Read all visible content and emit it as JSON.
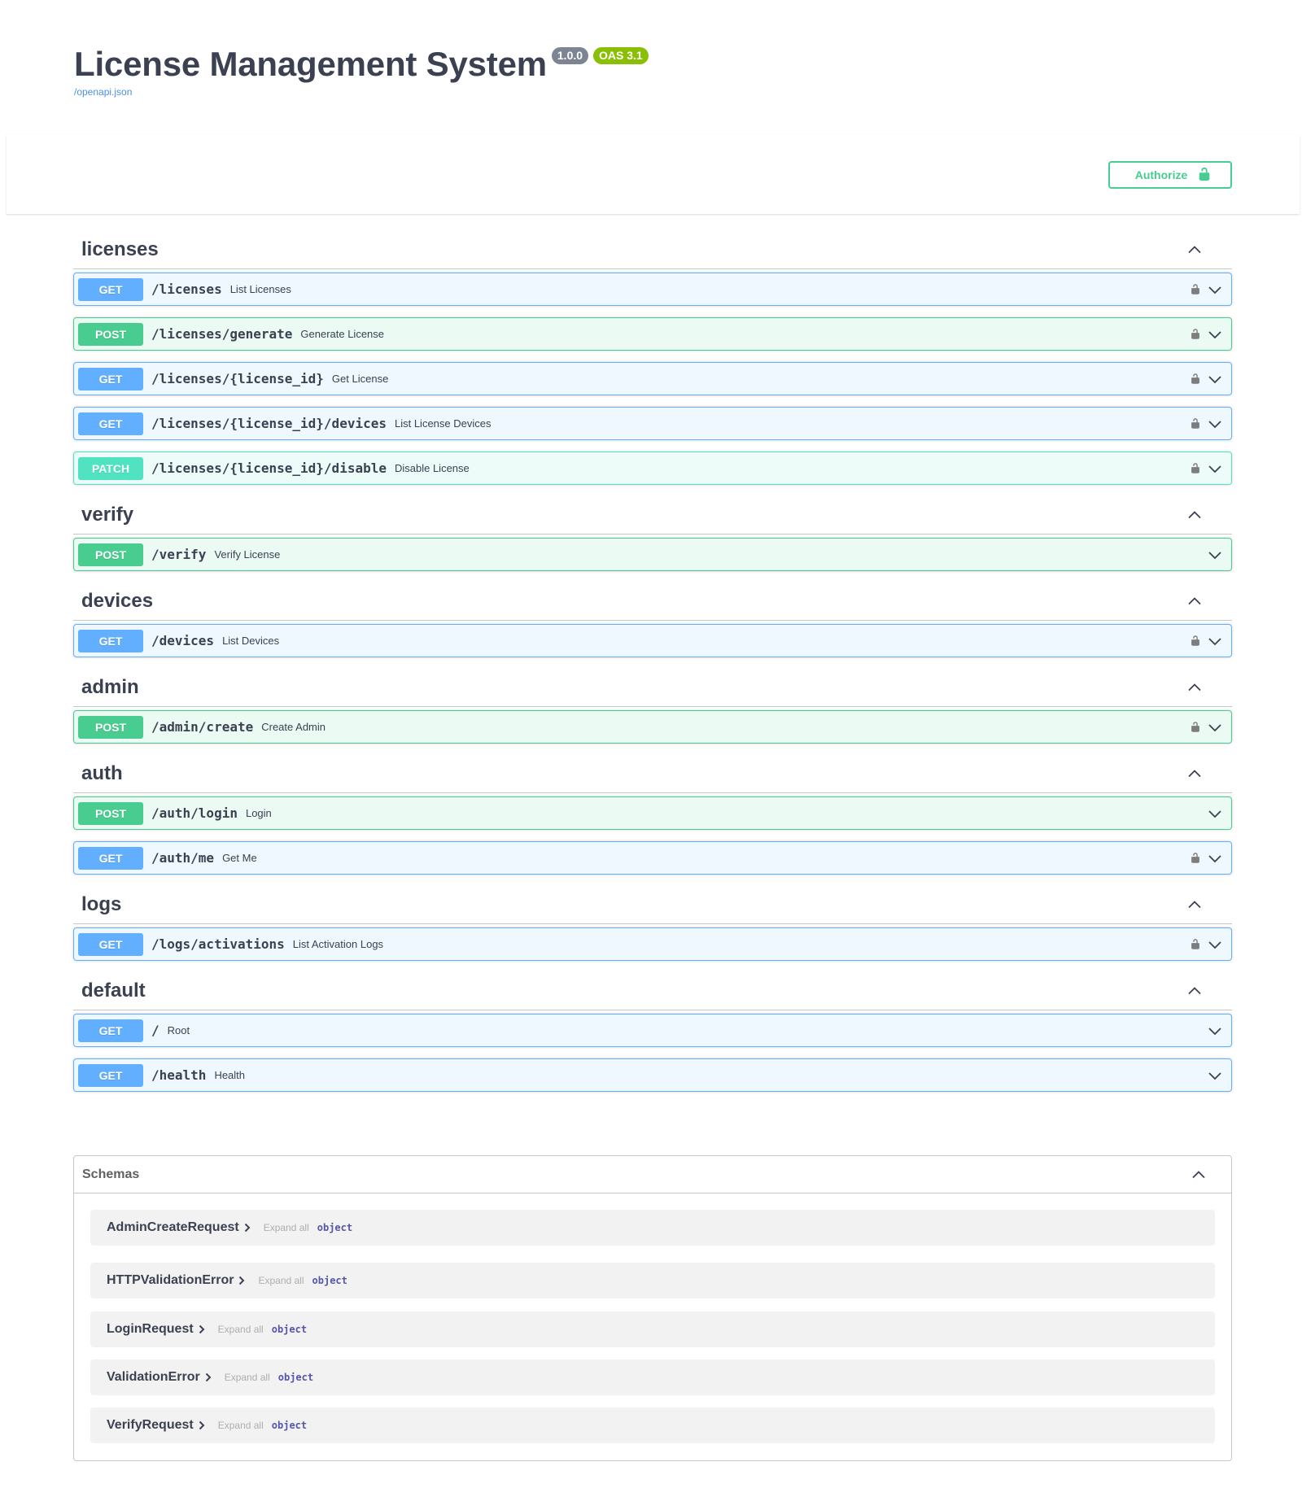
{
  "info": {
    "title": "License Management System",
    "version": "1.0.0",
    "oas": "OAS 3.1",
    "spec_link": "/openapi.json"
  },
  "authorize": {
    "label": "Authorize"
  },
  "tags": [
    {
      "name": "licenses",
      "operations": [
        {
          "method": "GET",
          "path": "/licenses",
          "summary": "List Licenses",
          "locked": true
        },
        {
          "method": "POST",
          "path": "/licenses/generate",
          "summary": "Generate License",
          "locked": true
        },
        {
          "method": "GET",
          "path": "/licenses/{license_id}",
          "summary": "Get License",
          "locked": true
        },
        {
          "method": "GET",
          "path": "/licenses/{license_id}/devices",
          "summary": "List License Devices",
          "locked": true
        },
        {
          "method": "PATCH",
          "path": "/licenses/{license_id}/disable",
          "summary": "Disable License",
          "locked": true
        }
      ]
    },
    {
      "name": "verify",
      "operations": [
        {
          "method": "POST",
          "path": "/verify",
          "summary": "Verify License",
          "locked": false
        }
      ]
    },
    {
      "name": "devices",
      "operations": [
        {
          "method": "GET",
          "path": "/devices",
          "summary": "List Devices",
          "locked": true
        }
      ]
    },
    {
      "name": "admin",
      "operations": [
        {
          "method": "POST",
          "path": "/admin/create",
          "summary": "Create Admin",
          "locked": true
        }
      ]
    },
    {
      "name": "auth",
      "operations": [
        {
          "method": "POST",
          "path": "/auth/login",
          "summary": "Login",
          "locked": false
        },
        {
          "method": "GET",
          "path": "/auth/me",
          "summary": "Get Me",
          "locked": true
        }
      ]
    },
    {
      "name": "logs",
      "operations": [
        {
          "method": "GET",
          "path": "/logs/activations",
          "summary": "List Activation Logs",
          "locked": true
        }
      ]
    },
    {
      "name": "default",
      "operations": [
        {
          "method": "GET",
          "path": "/",
          "summary": "Root",
          "locked": false
        },
        {
          "method": "GET",
          "path": "/health",
          "summary": "Health",
          "locked": false
        }
      ]
    }
  ],
  "schemas": {
    "title": "Schemas",
    "items": [
      {
        "name": "AdminCreateRequest",
        "expand": "Expand all",
        "type": "object"
      },
      {
        "name": "HTTPValidationError",
        "expand": "Expand all",
        "type": "object"
      },
      {
        "name": "LoginRequest",
        "expand": "Expand all",
        "type": "object"
      },
      {
        "name": "ValidationError",
        "expand": "Expand all",
        "type": "object"
      },
      {
        "name": "VerifyRequest",
        "expand": "Expand all",
        "type": "object"
      }
    ]
  },
  "colors": {
    "get": "#61affe",
    "post": "#49cc90",
    "patch": "#50e3c2",
    "authorize": "#49cc90"
  },
  "icons": {
    "lock": "lock-icon",
    "chevron_down": "chevron-down-icon",
    "chevron_up": "chevron-up-icon",
    "chevron_right": "chevron-right-icon"
  }
}
